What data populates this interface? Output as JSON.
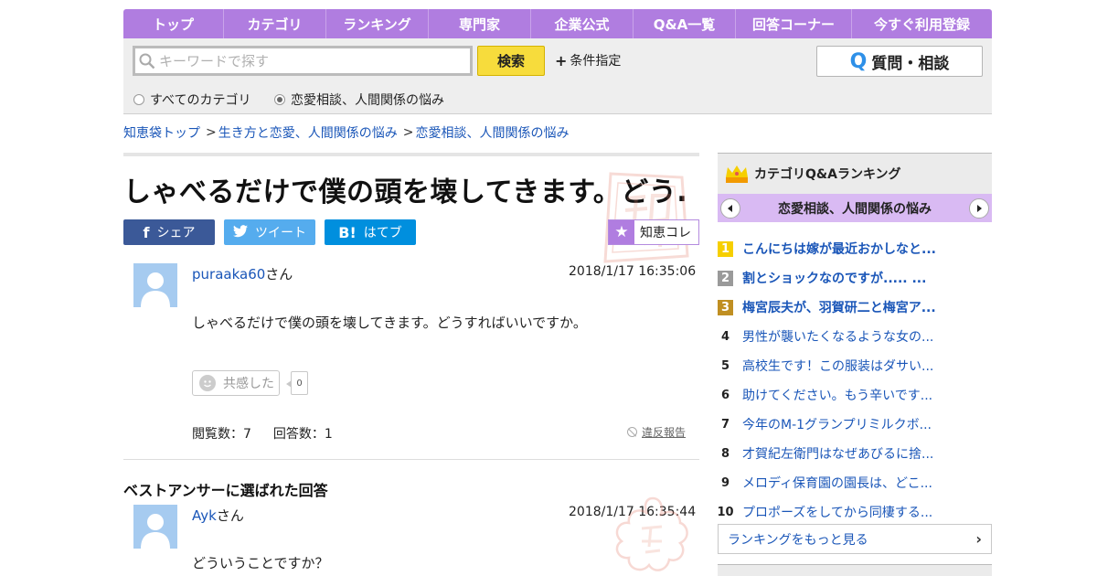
{
  "nav": {
    "items": [
      "トップ",
      "カテゴリ",
      "ランキング",
      "専門家",
      "企業公式",
      "Q&A一覧",
      "回答コーナー",
      "今すぐ利用登録"
    ]
  },
  "search": {
    "placeholder": "キーワードで探す",
    "button_label": "検索",
    "condition_label": "条件指定",
    "ask_button_label": "質問・相談",
    "scope_all_label": "すべてのカテゴリ",
    "scope_category_label": "恋愛相談、人間関係の悩み",
    "selected_scope": "恋愛相談、人間関係の悩み"
  },
  "breadcrumb": {
    "items": [
      "知恵袋トップ",
      "生き方と恋愛、人間関係の悩み",
      "恋愛相談、人間関係の悩み"
    ],
    "separator": ">"
  },
  "question": {
    "title": "しゃべるだけで僕の頭を壊してきます。どう...",
    "user": "puraaka60",
    "user_suffix": "さん",
    "time": "2018/1/17  16:35:06",
    "body": "しゃべるだけで僕の頭を壊してきます。どうすればいいですか。",
    "empathy_label": "共感した",
    "empathy_count": "0",
    "views": "閲覧数：7",
    "answers": "回答数：1",
    "report_label": "違反報告"
  },
  "share": {
    "facebook_label": "シェア",
    "twitter_label": "ツイート",
    "hatena_label": "はてブ",
    "collection_label": "知恵コレ",
    "facebook_icon": "f",
    "hatena_icon": "B!"
  },
  "best_answer": {
    "heading": "ベストアンサーに選ばれた回答",
    "user": "Ayk",
    "user_suffix": "さん",
    "time": "2018/1/17  16:35:44",
    "body": "どういうことですか？"
  },
  "ranking": {
    "title": "カテゴリQ&Aランキング",
    "category": "恋愛相談、人間関係の悩み",
    "items": [
      {
        "rank": "1",
        "text": "こんにちは嫁が最近おかしなと..."
      },
      {
        "rank": "2",
        "text": "割とショックなのですが..... ..."
      },
      {
        "rank": "3",
        "text": "梅宮辰夫が、羽賀研二と梅宮ア..."
      },
      {
        "rank": "4",
        "text": "男性が襲いたくなるような女の..."
      },
      {
        "rank": "5",
        "text": "高校生です！この服装はダサい..."
      },
      {
        "rank": "6",
        "text": "助けてください。もう辛いです..."
      },
      {
        "rank": "7",
        "text": "今年のM-1グランプリミルクボ..."
      },
      {
        "rank": "8",
        "text": "才賀紀左衛門はなぜあびるに捨..."
      },
      {
        "rank": "9",
        "text": "メロディ保育園の園長は、どこ..."
      },
      {
        "rank": "10",
        "text": "プロポーズをしてから同棲する..."
      }
    ],
    "more_label": "ランキングをもっと見る"
  },
  "colors": {
    "nav_purple": "#b07de0",
    "link_blue": "#1a56b8",
    "search_yellow": "#f7dc3c",
    "facebook": "#3b5998",
    "twitter": "#55acee",
    "hatena": "#008fde",
    "rank_gold": "#f6cf00",
    "rank_silver": "#9a9a9a",
    "rank_bronze": "#c08f22"
  },
  "icons": {
    "search": "magnifier-icon",
    "condition": "plus-icon",
    "ask": "q-icon",
    "collection": "star-icon",
    "ranking": "crown-icon",
    "prev": "arrow-left-icon",
    "next": "arrow-right-icon",
    "report": "ban-icon",
    "more": "chevron-right-icon"
  }
}
